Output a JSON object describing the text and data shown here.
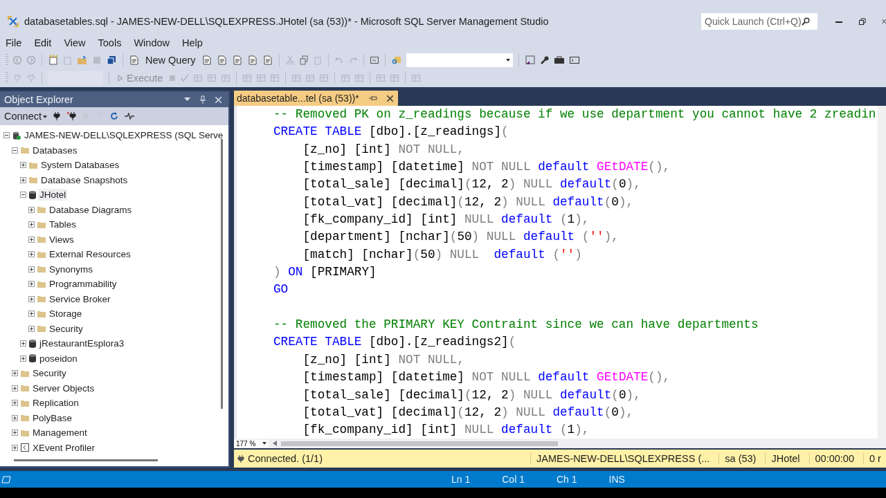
{
  "window": {
    "title": "databasetables.sql - JAMES-NEW-DELL\\SQLEXPRESS.JHotel (sa (53))* - Microsoft SQL Server Management Studio",
    "quick_launch": {
      "placeholder": "Quick Launch (Ctrl+Q)"
    }
  },
  "menu": [
    "File",
    "Edit",
    "View",
    "Tools",
    "Window",
    "Help"
  ],
  "toolbar": {
    "new_query": {
      "label": "New Query",
      "disabled": false
    },
    "execute": {
      "label": "Execute",
      "disabled": true
    }
  },
  "object_explorer": {
    "title": "Object Explorer",
    "connect": "Connect",
    "tree": [
      {
        "label": "JAMES-NEW-DELL\\SQLEXPRESS (SQL Serve",
        "kind": "server",
        "expanded": true,
        "selected": false,
        "children": [
          {
            "label": "Databases",
            "kind": "folder",
            "expanded": true,
            "selected": false,
            "children": [
              {
                "label": "System Databases",
                "kind": "folder",
                "expanded": false,
                "selected": false
              },
              {
                "label": "Database Snapshots",
                "kind": "folder",
                "expanded": false,
                "selected": false
              },
              {
                "label": "JHotel",
                "kind": "database",
                "expanded": true,
                "selected": true,
                "children": [
                  {
                    "label": "Database Diagrams",
                    "kind": "folder",
                    "expanded": false,
                    "selected": false
                  },
                  {
                    "label": "Tables",
                    "kind": "folder",
                    "expanded": false,
                    "selected": false
                  },
                  {
                    "label": "Views",
                    "kind": "folder",
                    "expanded": false,
                    "selected": false
                  },
                  {
                    "label": "External Resources",
                    "kind": "folder",
                    "expanded": false,
                    "selected": false
                  },
                  {
                    "label": "Synonyms",
                    "kind": "folder",
                    "expanded": false,
                    "selected": false
                  },
                  {
                    "label": "Programmability",
                    "kind": "folder",
                    "expanded": false,
                    "selected": false
                  },
                  {
                    "label": "Service Broker",
                    "kind": "folder",
                    "expanded": false,
                    "selected": false
                  },
                  {
                    "label": "Storage",
                    "kind": "folder",
                    "expanded": false,
                    "selected": false
                  },
                  {
                    "label": "Security",
                    "kind": "folder",
                    "expanded": false,
                    "selected": false
                  }
                ]
              },
              {
                "label": "jRestaurantEsplora3",
                "kind": "database",
                "expanded": false,
                "selected": false
              },
              {
                "label": "poseidon",
                "kind": "database",
                "expanded": false,
                "selected": false
              }
            ]
          },
          {
            "label": "Security",
            "kind": "folder",
            "expanded": false,
            "selected": false
          },
          {
            "label": "Server Objects",
            "kind": "folder",
            "expanded": false,
            "selected": false
          },
          {
            "label": "Replication",
            "kind": "folder",
            "expanded": false,
            "selected": false
          },
          {
            "label": "PolyBase",
            "kind": "folder",
            "expanded": false,
            "selected": false
          },
          {
            "label": "Management",
            "kind": "folder",
            "expanded": false,
            "selected": false
          },
          {
            "label": "XEvent Profiler",
            "kind": "profiler",
            "expanded": false,
            "selected": false
          }
        ]
      }
    ]
  },
  "editor": {
    "tab": {
      "label": "databasetable...tel (sa (53))*",
      "selected": true
    },
    "lines": [
      {
        "tokens": [
          {
            "kind": "comment",
            "text": "-- Removed PK on z_readings because if we use department you cannot have 2 zreadin"
          }
        ]
      },
      {
        "tokens": [
          {
            "kind": "keyword",
            "text": "CREATE TABLE"
          },
          {
            "kind": "plain",
            "text": " [dbo].[z_readings]"
          },
          {
            "kind": "operator",
            "text": "("
          }
        ]
      },
      {
        "tokens": [
          {
            "kind": "plain",
            "text": "    [z_no] [int] "
          },
          {
            "kind": "operator",
            "text": "NOT NULL,"
          }
        ]
      },
      {
        "tokens": [
          {
            "kind": "plain",
            "text": "    [timestamp] [datetime] "
          },
          {
            "kind": "operator",
            "text": "NOT NULL "
          },
          {
            "kind": "keyword",
            "text": "default "
          },
          {
            "kind": "function",
            "text": "GEtDATE"
          },
          {
            "kind": "operator",
            "text": "(),"
          }
        ]
      },
      {
        "tokens": [
          {
            "kind": "plain",
            "text": "    [total_sale] [decimal]"
          },
          {
            "kind": "operator",
            "text": "("
          },
          {
            "kind": "plain",
            "text": "12, 2"
          },
          {
            "kind": "operator",
            "text": ") NULL "
          },
          {
            "kind": "keyword",
            "text": "default"
          },
          {
            "kind": "operator",
            "text": "("
          },
          {
            "kind": "plain",
            "text": "0"
          },
          {
            "kind": "operator",
            "text": "),"
          }
        ]
      },
      {
        "tokens": [
          {
            "kind": "plain",
            "text": "    [total_vat] [decimal]"
          },
          {
            "kind": "operator",
            "text": "("
          },
          {
            "kind": "plain",
            "text": "12, 2"
          },
          {
            "kind": "operator",
            "text": ") NULL "
          },
          {
            "kind": "keyword",
            "text": "default"
          },
          {
            "kind": "operator",
            "text": "("
          },
          {
            "kind": "plain",
            "text": "0"
          },
          {
            "kind": "operator",
            "text": "),"
          }
        ]
      },
      {
        "tokens": [
          {
            "kind": "plain",
            "text": "    [fk_company_id] [int] "
          },
          {
            "kind": "operator",
            "text": "NULL "
          },
          {
            "kind": "keyword",
            "text": "default "
          },
          {
            "kind": "operator",
            "text": "("
          },
          {
            "kind": "plain",
            "text": "1"
          },
          {
            "kind": "operator",
            "text": "),"
          }
        ]
      },
      {
        "tokens": [
          {
            "kind": "plain",
            "text": "    [department] [nchar]"
          },
          {
            "kind": "operator",
            "text": "("
          },
          {
            "kind": "plain",
            "text": "50"
          },
          {
            "kind": "operator",
            "text": ") NULL "
          },
          {
            "kind": "keyword",
            "text": "default "
          },
          {
            "kind": "operator",
            "text": "("
          },
          {
            "kind": "string",
            "text": "''"
          },
          {
            "kind": "operator",
            "text": "),"
          }
        ]
      },
      {
        "tokens": [
          {
            "kind": "plain",
            "text": "    [match] [nchar]"
          },
          {
            "kind": "operator",
            "text": "("
          },
          {
            "kind": "plain",
            "text": "50"
          },
          {
            "kind": "operator",
            "text": ") NULL  "
          },
          {
            "kind": "keyword",
            "text": "default "
          },
          {
            "kind": "operator",
            "text": "("
          },
          {
            "kind": "string",
            "text": "''"
          },
          {
            "kind": "operator",
            "text": ")"
          }
        ]
      },
      {
        "tokens": [
          {
            "kind": "operator",
            "text": ") "
          },
          {
            "kind": "keyword",
            "text": "ON "
          },
          {
            "kind": "plain",
            "text": "[PRIMARY]"
          }
        ]
      },
      {
        "tokens": [
          {
            "kind": "keyword",
            "text": "GO"
          }
        ]
      },
      {
        "space_before": true,
        "tokens": [
          {
            "kind": "comment",
            "text": "-- Removed the PRIMARY KEY Contraint since we can have departments"
          }
        ]
      },
      {
        "tokens": [
          {
            "kind": "keyword",
            "text": "CREATE TABLE"
          },
          {
            "kind": "plain",
            "text": " [dbo].[z_readings2]"
          },
          {
            "kind": "operator",
            "text": "("
          }
        ]
      },
      {
        "tokens": [
          {
            "kind": "plain",
            "text": "    [z_no] [int] "
          },
          {
            "kind": "operator",
            "text": "NOT NULL,"
          }
        ]
      },
      {
        "tokens": [
          {
            "kind": "plain",
            "text": "    [timestamp] [datetime] "
          },
          {
            "kind": "operator",
            "text": "NOT NULL "
          },
          {
            "kind": "keyword",
            "text": "default "
          },
          {
            "kind": "function",
            "text": "GEtDATE"
          },
          {
            "kind": "operator",
            "text": "(),"
          }
        ]
      },
      {
        "tokens": [
          {
            "kind": "plain",
            "text": "    [total_sale] [decimal]"
          },
          {
            "kind": "operator",
            "text": "("
          },
          {
            "kind": "plain",
            "text": "12, 2"
          },
          {
            "kind": "operator",
            "text": ") NULL "
          },
          {
            "kind": "keyword",
            "text": "default"
          },
          {
            "kind": "operator",
            "text": "("
          },
          {
            "kind": "plain",
            "text": "0"
          },
          {
            "kind": "operator",
            "text": "),"
          }
        ]
      },
      {
        "tokens": [
          {
            "kind": "plain",
            "text": "    [total_vat] [decimal]"
          },
          {
            "kind": "operator",
            "text": "("
          },
          {
            "kind": "plain",
            "text": "12, 2"
          },
          {
            "kind": "operator",
            "text": ") NULL "
          },
          {
            "kind": "keyword",
            "text": "default"
          },
          {
            "kind": "operator",
            "text": "("
          },
          {
            "kind": "plain",
            "text": "0"
          },
          {
            "kind": "operator",
            "text": "),"
          }
        ]
      },
      {
        "tokens": [
          {
            "kind": "plain",
            "text": "    [fk_company_id] [int] "
          },
          {
            "kind": "operator",
            "text": "NULL "
          },
          {
            "kind": "keyword",
            "text": "default "
          },
          {
            "kind": "operator",
            "text": "("
          },
          {
            "kind": "plain",
            "text": "1"
          },
          {
            "kind": "operator",
            "text": "),"
          }
        ]
      }
    ],
    "zoom": "177 %"
  },
  "query_status": {
    "message": "Connected. (1/1)",
    "server": "JAMES-NEW-DELL\\SQLEXPRESS (...",
    "user": "sa (53)",
    "database": "JHotel",
    "elapsed": "00:00:00",
    "rows": "0 r"
  },
  "status_bar": {
    "line": "Ln 1",
    "column": "Col 1",
    "char": "Ch 1",
    "mode": "INS"
  }
}
